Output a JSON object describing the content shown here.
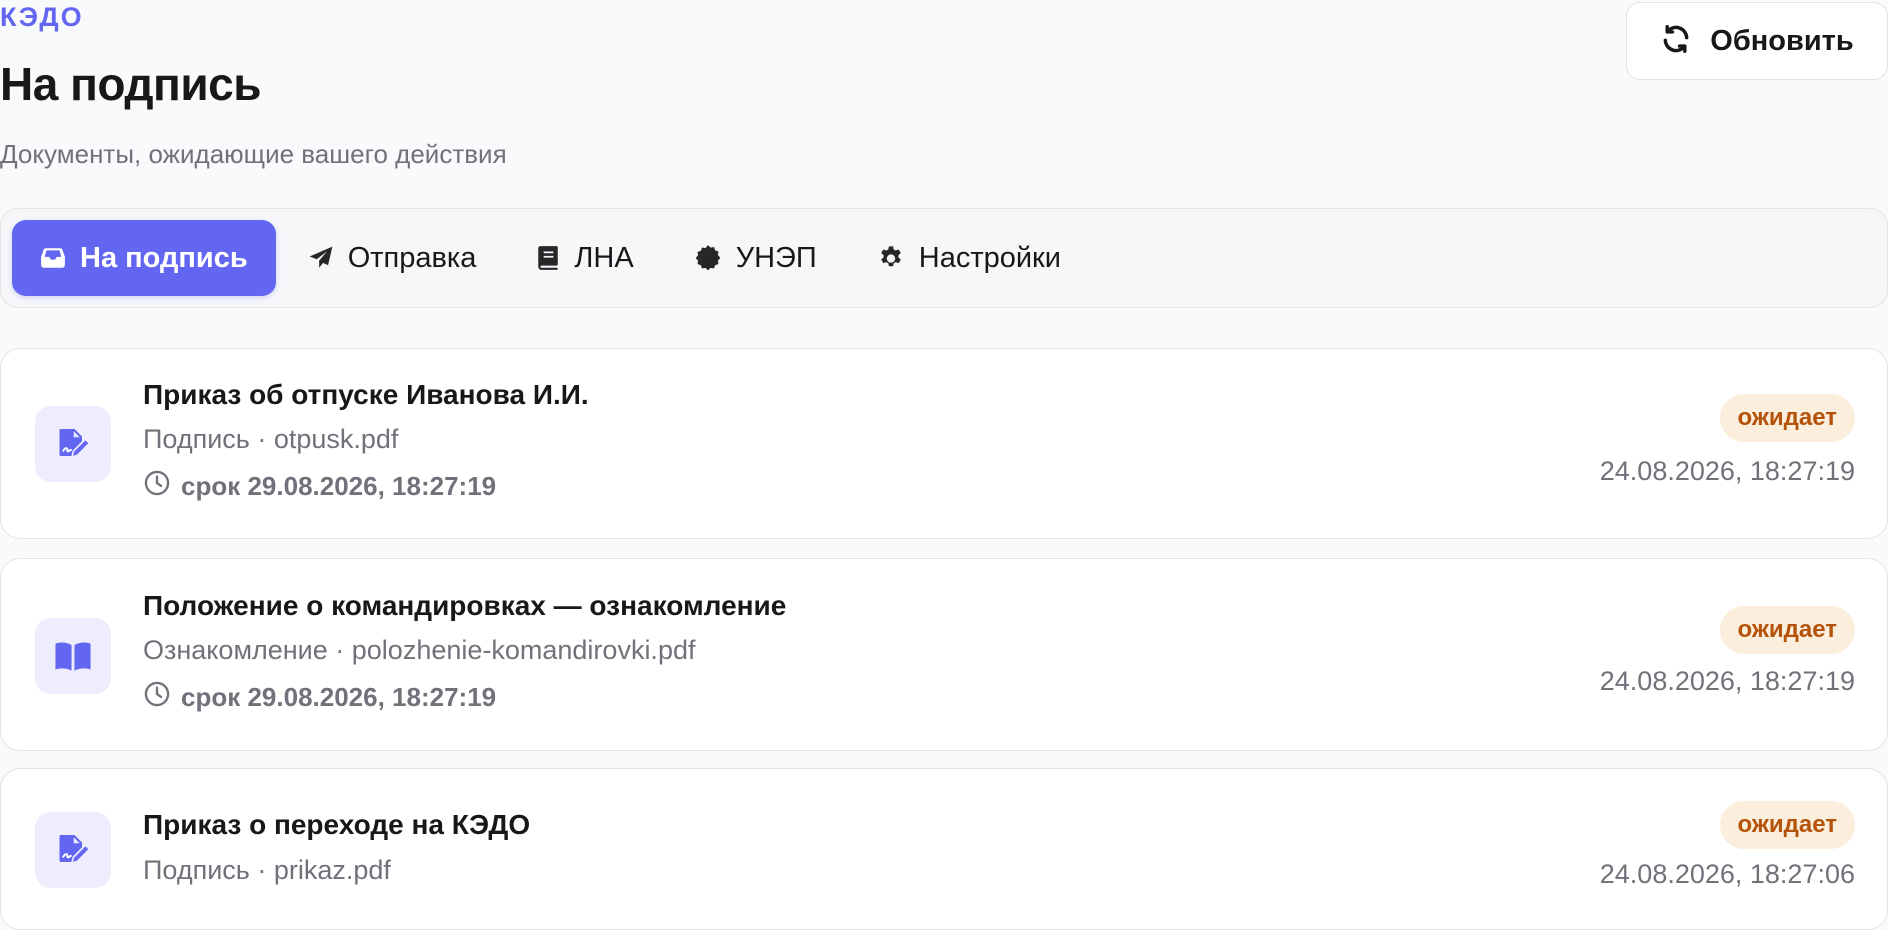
{
  "brand": "КЭДО",
  "page_title": "На подпись",
  "subtitle": "Документы, ожидающие вашего действия",
  "refresh_button": {
    "label": "Обновить",
    "icon": "refresh-icon"
  },
  "tabs": [
    {
      "label": "На подпись",
      "icon": "inbox-icon",
      "active": true
    },
    {
      "label": "Отправка",
      "icon": "paper-plane-icon",
      "active": false
    },
    {
      "label": "ЛНА",
      "icon": "book-icon",
      "active": false
    },
    {
      "label": "УНЭП",
      "icon": "certificate-icon",
      "active": false
    },
    {
      "label": "Настройки",
      "icon": "gear-icon",
      "active": false
    }
  ],
  "documents": [
    {
      "title": "Приказ об отпуске Иванова И.И.",
      "meta": "Подпись · otpusk.pdf",
      "deadline": "срок 29.08.2026, 18:27:19",
      "status": "ожидает",
      "date": "24.08.2026, 18:27:19",
      "icon": "file-signature-icon"
    },
    {
      "title": "Положение о командировках — ознакомление",
      "meta": "Ознакомление · polozhenie-komandirovki.pdf",
      "deadline": "срок 29.08.2026, 18:27:19",
      "status": "ожидает",
      "date": "24.08.2026, 18:27:19",
      "icon": "open-book-icon"
    },
    {
      "title": "Приказ о переходе на КЭДО",
      "meta": "Подпись · prikaz.pdf",
      "deadline": "",
      "status": "ожидает",
      "date": "24.08.2026, 18:27:06",
      "icon": "file-signature-icon"
    }
  ],
  "colors": {
    "accent": "#6366f1",
    "status_bg": "#fbeedc",
    "status_text": "#b45309",
    "muted_text": "#71717a"
  }
}
